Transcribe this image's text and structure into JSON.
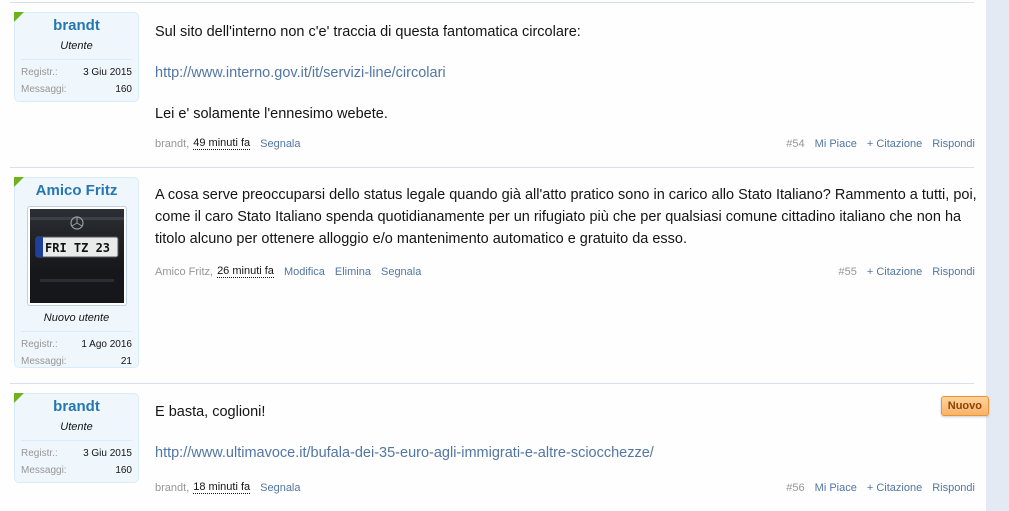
{
  "posts": [
    {
      "username": "brandt",
      "usertitle": "Utente",
      "reg_label": "Registr.:",
      "reg_value": "3 Giu 2015",
      "msg_label": "Messaggi:",
      "msg_value": "160",
      "line1": "Sul sito dell'interno non c'e' traccia di questa fantomatica circolare:",
      "link": "http://www.interno.gov.it/it/servizi-line/circolari",
      "line2": "Lei e' solamente l'ennesimo webete.",
      "author_prefix": "brandt,",
      "time": "49 minuti fa",
      "report": "Segnala",
      "number": "#54",
      "like": "Mi Piace",
      "quote": "+ Citazione",
      "reply": "Rispondi"
    },
    {
      "username": "Amico Fritz",
      "usertitle": "Nuovo utente",
      "avatar_plate": "FRI TZ 23",
      "reg_label": "Registr.:",
      "reg_value": "1 Ago 2016",
      "msg_label": "Messaggi:",
      "msg_value": "21",
      "body": "A cosa serve preoccuparsi dello status legale quando già all'atto pratico sono in carico allo Stato Italiano? Rammento a tutti, poi, come il caro Stato Italiano spenda quotidianamente per un rifugiato più che per qualsiasi comune cittadino italiano che non ha titolo alcuno per ottenere alloggio e/o mantenimento automatico e gratuito da esso.",
      "author_prefix": "Amico Fritz,",
      "time": "26 minuti fa",
      "edit": "Modifica",
      "delete": "Elimina",
      "report": "Segnala",
      "number": "#55",
      "quote": "+ Citazione",
      "reply": "Rispondi"
    },
    {
      "username": "brandt",
      "usertitle": "Utente",
      "reg_label": "Registr.:",
      "reg_value": "3 Giu 2015",
      "msg_label": "Messaggi:",
      "msg_value": "160",
      "line1": "E basta, coglioni!",
      "link": "http://www.ultimavoce.it/bufala-dei-35-euro-agli-immigrati-e-altre-sciocchezze/",
      "badge": "Nuovo",
      "author_prefix": "brandt,",
      "time": "18 minuti fa",
      "report": "Segnala",
      "number": "#56",
      "like": "Mi Piace",
      "quote": "+ Citazione",
      "reply": "Rispondi"
    }
  ]
}
